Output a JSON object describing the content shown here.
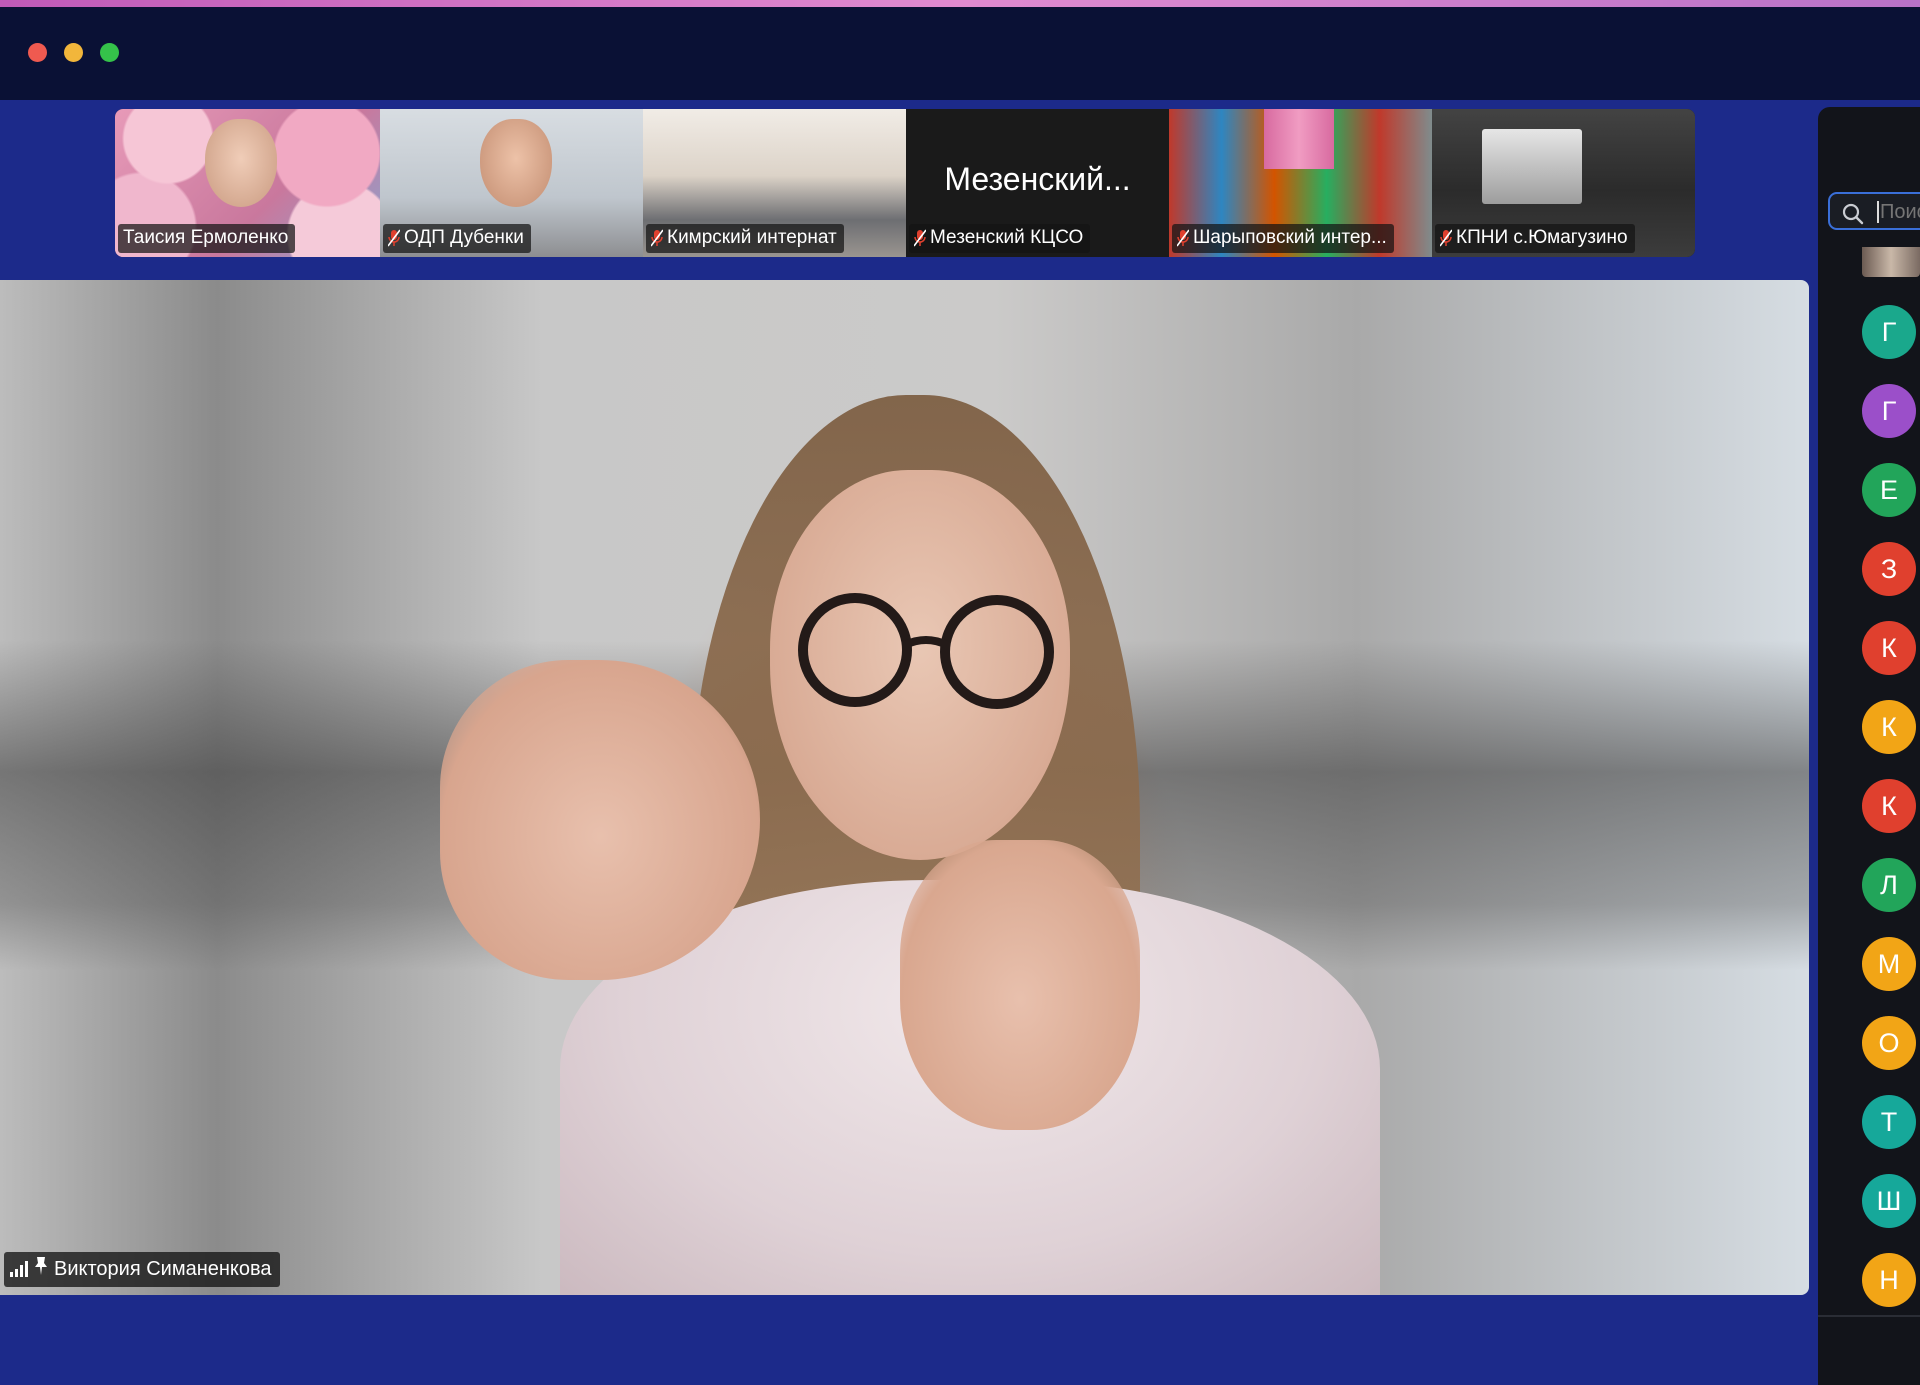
{
  "window": {
    "controls": [
      "close",
      "minimize",
      "maximize"
    ]
  },
  "thumbnails": [
    {
      "name": "Таисия Ермоленко",
      "muted": false
    },
    {
      "name": "ОДП Дубенки",
      "muted": true
    },
    {
      "name": "Кимрский интернат",
      "muted": true
    },
    {
      "name": "Мезенский КЦСО",
      "muted": true,
      "display_name": "Мезенский..."
    },
    {
      "name": "Шарыповский интер...",
      "muted": true
    },
    {
      "name": "КПНИ с.Юмагузино",
      "muted": true
    }
  ],
  "main_speaker": {
    "name": "Виктория Симаненкова",
    "pinned": true
  },
  "participants_panel": {
    "search_placeholder": "Поиск",
    "avatars": [
      {
        "letter": "Г",
        "color": "#1aa88c"
      },
      {
        "letter": "Г",
        "color": "#9b4fc9"
      },
      {
        "letter": "Е",
        "color": "#22a55a"
      },
      {
        "letter": "З",
        "color": "#e0402e"
      },
      {
        "letter": "К",
        "color": "#e0402e"
      },
      {
        "letter": "К",
        "color": "#f2a516"
      },
      {
        "letter": "К",
        "color": "#e0402e"
      },
      {
        "letter": "Л",
        "color": "#22a55a"
      },
      {
        "letter": "М",
        "color": "#f2a516"
      },
      {
        "letter": "О",
        "color": "#f2a516"
      },
      {
        "letter": "Т",
        "color": "#16a89a"
      },
      {
        "letter": "Ш",
        "color": "#16a89a"
      },
      {
        "letter": "Н",
        "color": "#f2a516"
      }
    ]
  },
  "colors": {
    "background": "#1c2a8a",
    "titlebar": "#0a1135",
    "panel": "#12141a",
    "accent": "#3a6fd8",
    "mute_icon": "#e0402e"
  }
}
